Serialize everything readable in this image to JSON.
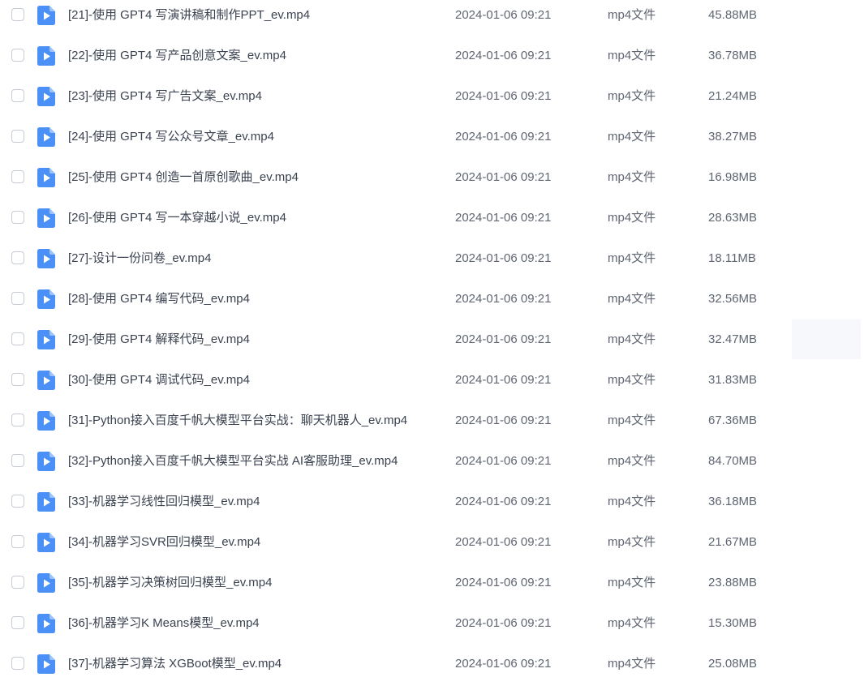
{
  "files": [
    {
      "name": "[21]-使用 GPT4 写演讲稿和制作PPT_ev.mp4",
      "date": "2024-01-06 09:21",
      "type": "mp4文件",
      "size": "45.88MB"
    },
    {
      "name": "[22]-使用 GPT4 写产品创意文案_ev.mp4",
      "date": "2024-01-06 09:21",
      "type": "mp4文件",
      "size": "36.78MB"
    },
    {
      "name": "[23]-使用 GPT4 写广告文案_ev.mp4",
      "date": "2024-01-06 09:21",
      "type": "mp4文件",
      "size": "21.24MB"
    },
    {
      "name": "[24]-使用 GPT4 写公众号文章_ev.mp4",
      "date": "2024-01-06 09:21",
      "type": "mp4文件",
      "size": "38.27MB"
    },
    {
      "name": "[25]-使用 GPT4 创造一首原创歌曲_ev.mp4",
      "date": "2024-01-06 09:21",
      "type": "mp4文件",
      "size": "16.98MB"
    },
    {
      "name": "[26]-使用 GPT4 写一本穿越小说_ev.mp4",
      "date": "2024-01-06 09:21",
      "type": "mp4文件",
      "size": "28.63MB"
    },
    {
      "name": "[27]-设计一份问卷_ev.mp4",
      "date": "2024-01-06 09:21",
      "type": "mp4文件",
      "size": "18.11MB"
    },
    {
      "name": "[28]-使用 GPT4 编写代码_ev.mp4",
      "date": "2024-01-06 09:21",
      "type": "mp4文件",
      "size": "32.56MB"
    },
    {
      "name": "[29]-使用 GPT4 解释代码_ev.mp4",
      "date": "2024-01-06 09:21",
      "type": "mp4文件",
      "size": "32.47MB"
    },
    {
      "name": "[30]-使用 GPT4 调试代码_ev.mp4",
      "date": "2024-01-06 09:21",
      "type": "mp4文件",
      "size": "31.83MB"
    },
    {
      "name": "[31]-Python接入百度千帆大模型平台实战：聊天机器人_ev.mp4",
      "date": "2024-01-06 09:21",
      "type": "mp4文件",
      "size": "67.36MB"
    },
    {
      "name": "[32]-Python接入百度千帆大模型平台实战 AI客服助理_ev.mp4",
      "date": "2024-01-06 09:21",
      "type": "mp4文件",
      "size": "84.70MB"
    },
    {
      "name": "[33]-机器学习线性回归模型_ev.mp4",
      "date": "2024-01-06 09:21",
      "type": "mp4文件",
      "size": "36.18MB"
    },
    {
      "name": "[34]-机器学习SVR回归模型_ev.mp4",
      "date": "2024-01-06 09:21",
      "type": "mp4文件",
      "size": "21.67MB"
    },
    {
      "name": "[35]-机器学习决策树回归模型_ev.mp4",
      "date": "2024-01-06 09:21",
      "type": "mp4文件",
      "size": "23.88MB"
    },
    {
      "name": "[36]-机器学习K Means模型_ev.mp4",
      "date": "2024-01-06 09:21",
      "type": "mp4文件",
      "size": "15.30MB"
    },
    {
      "name": "[37]-机器学习算法 XGBoot模型_ev.mp4",
      "date": "2024-01-06 09:21",
      "type": "mp4文件",
      "size": "25.08MB"
    }
  ],
  "icons": {
    "video_file": "video-file-icon"
  },
  "colors": {
    "icon_blue": "#4a90f7",
    "icon_fold": "#9cc4fb"
  }
}
